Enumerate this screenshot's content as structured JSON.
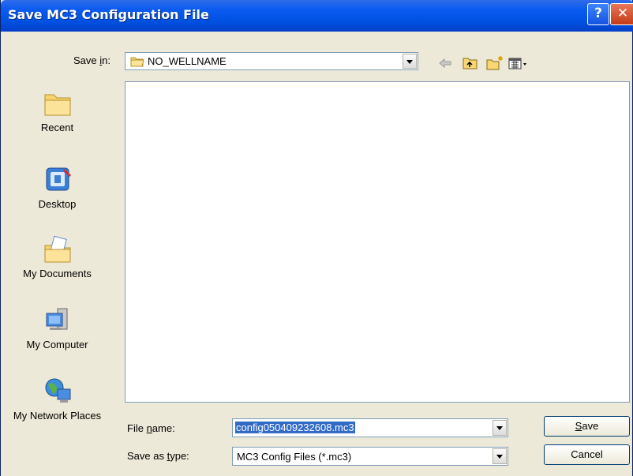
{
  "window": {
    "title": "Save MC3 Configuration File",
    "help_symbol": "?",
    "close_symbol": "✕"
  },
  "toolbar": {
    "save_in_label_pre": "Save ",
    "save_in_label_mnemonic": "i",
    "save_in_label_post": "n:",
    "current_folder": "NO_WELLNAME",
    "icons": [
      "back-arrow-icon",
      "up-folder-icon",
      "new-folder-icon",
      "view-menu-icon"
    ]
  },
  "places": [
    {
      "label": "Recent",
      "icon": "recent-folder-icon"
    },
    {
      "label": "Desktop",
      "icon": "desktop-icon"
    },
    {
      "label": "My Documents",
      "icon": "my-documents-icon"
    },
    {
      "label": "My Computer",
      "icon": "my-computer-icon"
    },
    {
      "label": "My Network Places",
      "icon": "network-places-icon"
    }
  ],
  "form": {
    "file_name_label_pre": "File ",
    "file_name_label_mnemonic": "n",
    "file_name_label_post": "ame:",
    "file_name_value": "config050409232608.mc3",
    "save_type_label_pre": "Save as ",
    "save_type_label_mnemonic": "t",
    "save_type_label_post": "ype:",
    "save_type_value": "MC3 Config Files (*.mc3)"
  },
  "buttons": {
    "save_mnemonic": "S",
    "save_rest": "ave",
    "cancel": "Cancel"
  }
}
